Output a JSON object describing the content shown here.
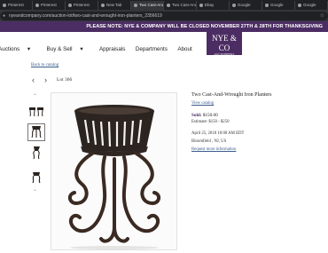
{
  "browser": {
    "tabs": [
      {
        "label": "Pinterest",
        "active": false
      },
      {
        "label": "Pinterest",
        "active": false
      },
      {
        "label": "Pinterest",
        "active": false
      },
      {
        "label": "New Tab",
        "active": false
      },
      {
        "label": "Two Cast-And-Wrought Iron Planters",
        "active": true
      },
      {
        "label": "Two Cast-And-Wrought",
        "active": false
      },
      {
        "label": "Ebay",
        "active": false
      },
      {
        "label": "Google",
        "active": false
      },
      {
        "label": "Google",
        "active": false
      },
      {
        "label": "Google",
        "active": false
      }
    ],
    "url": "nyeandcompany.com/auction-lot/two-cast-and-wrought-iron-planters_2356619"
  },
  "site": {
    "banner": "PLEASE NOTE: NYE & COMPANY WILL BE CLOSED NOVEMBER 27TH & 28TH FOR THANKSGIVING",
    "logo_main": "NYE & CO",
    "logo_sub": [
      "AUCTIONEERS",
      "APPRAISERS",
      "ANTIQUES"
    ],
    "nav": [
      {
        "label": "Auctions",
        "caret": true
      },
      {
        "label": "Buy & Sell",
        "caret": true
      },
      {
        "label": "Appraisals",
        "caret": false
      },
      {
        "label": "Departments",
        "caret": false
      },
      {
        "label": "About",
        "caret": false
      }
    ]
  },
  "lot": {
    "back_link": "Back to catalog",
    "prev": "‹",
    "next": "›",
    "label": "Lot 366",
    "title": "Two Cast-And-Wrought Iron Planters",
    "view_catalog": "View catalog",
    "sold_label": "Sold:",
    "sold_price": "$150.00",
    "estimate": "Estimate: $150 - $250",
    "date": "April 25, 2018 10:00 AM EDT",
    "location": "Bloomfield , NJ, US",
    "request_info": "Request more information"
  }
}
